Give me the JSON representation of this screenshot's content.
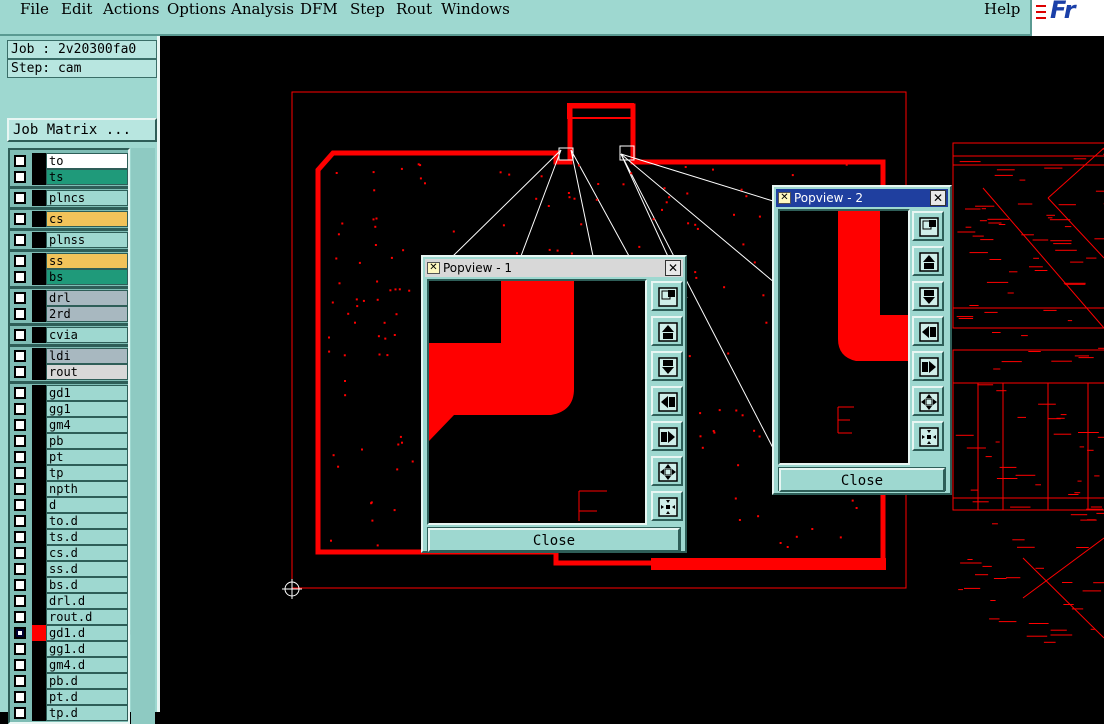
{
  "menu": {
    "file": "File",
    "edit": "Edit",
    "actions": "Actions",
    "options": "Options",
    "analysis": "Analysis",
    "dfm": "DFM",
    "step": "Step",
    "rout": "Rout",
    "windows": "Windows",
    "help": "Help"
  },
  "logo": {
    "text": "Fr"
  },
  "panel": {
    "job": "Job : 2v20300fa0",
    "step": "Step: cam",
    "job_matrix": "Job Matrix ..."
  },
  "layers": [
    {
      "name": "to",
      "color": "#ffffff"
    },
    {
      "name": "ts",
      "color": "#1f9a7a"
    },
    {
      "name": "plncs",
      "color": "#9ed8d0"
    },
    {
      "name": "cs",
      "color": "#f2c35a"
    },
    {
      "name": "plnss",
      "color": "#9ed8d0"
    },
    {
      "name": "ss",
      "color": "#f2c35a"
    },
    {
      "name": "bs",
      "color": "#1f9a7a"
    },
    {
      "name": "drl",
      "color": "#a8b8c0"
    },
    {
      "name": "2rd",
      "color": "#a8b8c0"
    },
    {
      "name": "cvia",
      "color": "#9ed8d0"
    },
    {
      "name": "ldi",
      "color": "#a8b8c0"
    },
    {
      "name": "rout",
      "color": "#d8d8d8"
    },
    {
      "name": "gd1",
      "color": "#9ed8d0"
    },
    {
      "name": "gg1",
      "color": "#9ed8d0"
    },
    {
      "name": "gm4",
      "color": "#9ed8d0"
    },
    {
      "name": "pb",
      "color": "#9ed8d0"
    },
    {
      "name": "pt",
      "color": "#9ed8d0"
    },
    {
      "name": "tp",
      "color": "#9ed8d0"
    },
    {
      "name": "npth",
      "color": "#9ed8d0"
    },
    {
      "name": "d",
      "color": "#9ed8d0"
    },
    {
      "name": "to.d",
      "color": "#9ed8d0"
    },
    {
      "name": "ts.d",
      "color": "#9ed8d0"
    },
    {
      "name": "cs.d",
      "color": "#9ed8d0"
    },
    {
      "name": "ss.d",
      "color": "#9ed8d0"
    },
    {
      "name": "bs.d",
      "color": "#9ed8d0"
    },
    {
      "name": "drl.d",
      "color": "#9ed8d0"
    },
    {
      "name": "rout.d",
      "color": "#9ed8d0"
    },
    {
      "name": "gd1.d",
      "color": "#9ed8d0",
      "active": true
    },
    {
      "name": "gg1.d",
      "color": "#9ed8d0"
    },
    {
      "name": "gm4.d",
      "color": "#9ed8d0"
    },
    {
      "name": "pb.d",
      "color": "#9ed8d0"
    },
    {
      "name": "pt.d",
      "color": "#9ed8d0"
    },
    {
      "name": "tp.d",
      "color": "#9ed8d0"
    }
  ],
  "popview1": {
    "title": "Popview - 1",
    "close": "Close"
  },
  "popview2": {
    "title": "Popview - 2",
    "close": "Close"
  },
  "colors": {
    "trace": "#ff0000",
    "panel": "#9ed8d0",
    "background": "#000000"
  }
}
